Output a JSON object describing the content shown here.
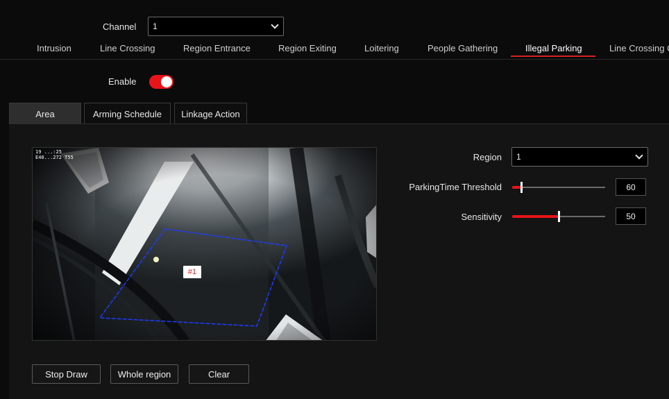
{
  "channel": {
    "label": "Channel",
    "value": "1"
  },
  "function_tabs": [
    {
      "label": "Intrusion"
    },
    {
      "label": "Line Crossing"
    },
    {
      "label": "Region Entrance"
    },
    {
      "label": "Region Exiting"
    },
    {
      "label": "Loitering"
    },
    {
      "label": "People Gathering"
    },
    {
      "label": "Illegal Parking"
    },
    {
      "label": "Line Crossing C"
    }
  ],
  "active_function_tab": "Illegal Parking",
  "enable": {
    "label": "Enable",
    "on": true
  },
  "sub_tabs": [
    {
      "label": "Area"
    },
    {
      "label": "Arming Schedule"
    },
    {
      "label": "Linkage Action"
    }
  ],
  "active_sub_tab": "Area",
  "video": {
    "osd_line1": "19 ...:25",
    "osd_line2": "E40...272 T55",
    "region_tag": "#1"
  },
  "settings": {
    "region": {
      "label": "Region",
      "value": "1"
    },
    "parking_time": {
      "label": "ParkingTime Threshold",
      "value": "60",
      "level": 0.1
    },
    "sensitivity": {
      "label": "Sensitivity",
      "value": "50",
      "level": 0.5
    }
  },
  "buttons": {
    "stop_draw": "Stop Draw",
    "whole_region": "Whole region",
    "clear": "Clear"
  },
  "colors": {
    "accent": "#e8141a",
    "background": "#0b0b0b",
    "panel": "#141414",
    "region_polygon": "#1e3cff"
  }
}
